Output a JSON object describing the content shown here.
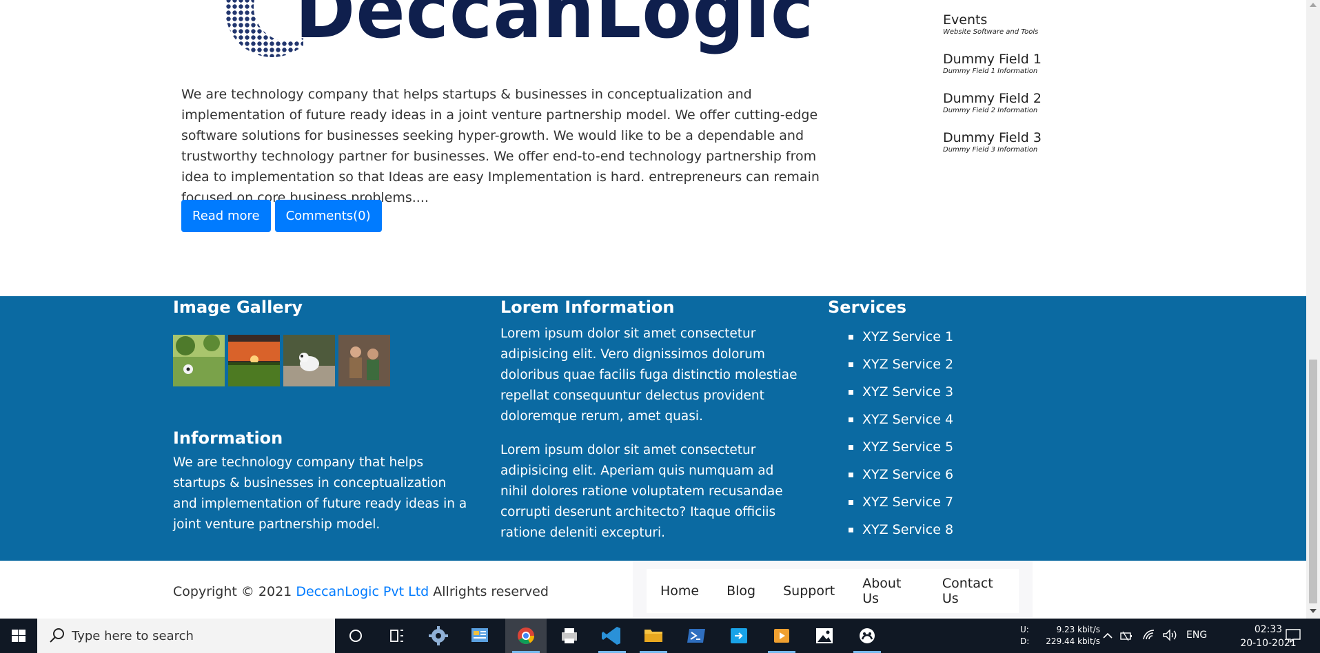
{
  "logo": {
    "text": "DeccanLogic"
  },
  "article": {
    "text": "We are technology company that helps startups & businesses in conceptualization and implementation of future ready ideas in a joint venture partnership model. We offer cutting-edge software solutions for businesses seeking hyper-growth. We would like to be a dependable and trustworthy technology partner for businesses. We offer end-to-end technology partnership from idea to implementation so that Ideas are easy Implementation is hard. entrepreneurs can remain focused on core business problems....",
    "read_more": "Read more",
    "comments": "Comments(0)"
  },
  "sidebar": {
    "items": [
      {
        "title": "Events",
        "subtitle": "Website Software and Tools"
      },
      {
        "title": "Dummy Field 1",
        "subtitle": "Dummy Field 1 Information"
      },
      {
        "title": "Dummy Field 2",
        "subtitle": "Dummy Field 2 Information"
      },
      {
        "title": "Dummy Field 3",
        "subtitle": "Dummy Field 3 Information"
      }
    ]
  },
  "footer": {
    "gallery": {
      "heading": "Image Gallery"
    },
    "information": {
      "heading": "Information",
      "text": "We are technology company that helps startups & businesses in conceptualization and implementation of future ready ideas in a joint venture partnership model."
    },
    "lorem": {
      "heading": "Lorem Information",
      "para1": "Lorem ipsum dolor sit amet consectetur adipisicing elit. Vero dignissimos dolorum doloribus quae facilis fuga distinctio molestiae repellat consequuntur delectus provident doloremque rerum, amet quasi.",
      "para2": "Lorem ipsum dolor sit amet consectetur adipisicing elit. Aperiam quis numquam ad nihil dolores ratione voluptatem recusandae corrupti deserunt architecto? Itaque officiis ratione deleniti excepturi."
    },
    "services": {
      "heading": "Services",
      "items": [
        "XYZ Service 1",
        "XYZ Service 2",
        "XYZ Service 3",
        "XYZ Service 4",
        "XYZ Service 5",
        "XYZ Service 6",
        "XYZ Service 7",
        "XYZ Service 8"
      ]
    },
    "background_color": "#0b6aa2"
  },
  "copyright": {
    "prefix": "Copyright © 2021",
    "company": "DeccanLogic Pvt Ltd",
    "suffix": "Allrights reserved"
  },
  "nav": {
    "items": [
      "Home",
      "Blog",
      "Support",
      "About Us",
      "Contact Us"
    ]
  },
  "taskbar": {
    "search_placeholder": "Type here to search",
    "apps": [
      "cortana-icon",
      "task-view-icon",
      "settings-icon",
      "control-panel-icon",
      "chrome-icon",
      "printer-icon",
      "vscode-icon",
      "file-explorer-icon",
      "powershell-icon",
      "remote-desktop-icon",
      "media-player-icon",
      "photos-icon",
      "xbox-icon"
    ],
    "net_up_label": "U:",
    "net_down_label": "D:",
    "net_up": "9.23 kbit/s",
    "net_down": "229.44 kbit/s",
    "language": "ENG",
    "time": "02:33",
    "date": "20-10-2021"
  },
  "colors": {
    "accent": "#007bff",
    "logo": "#0f1f4d",
    "taskbar": "#101824"
  }
}
